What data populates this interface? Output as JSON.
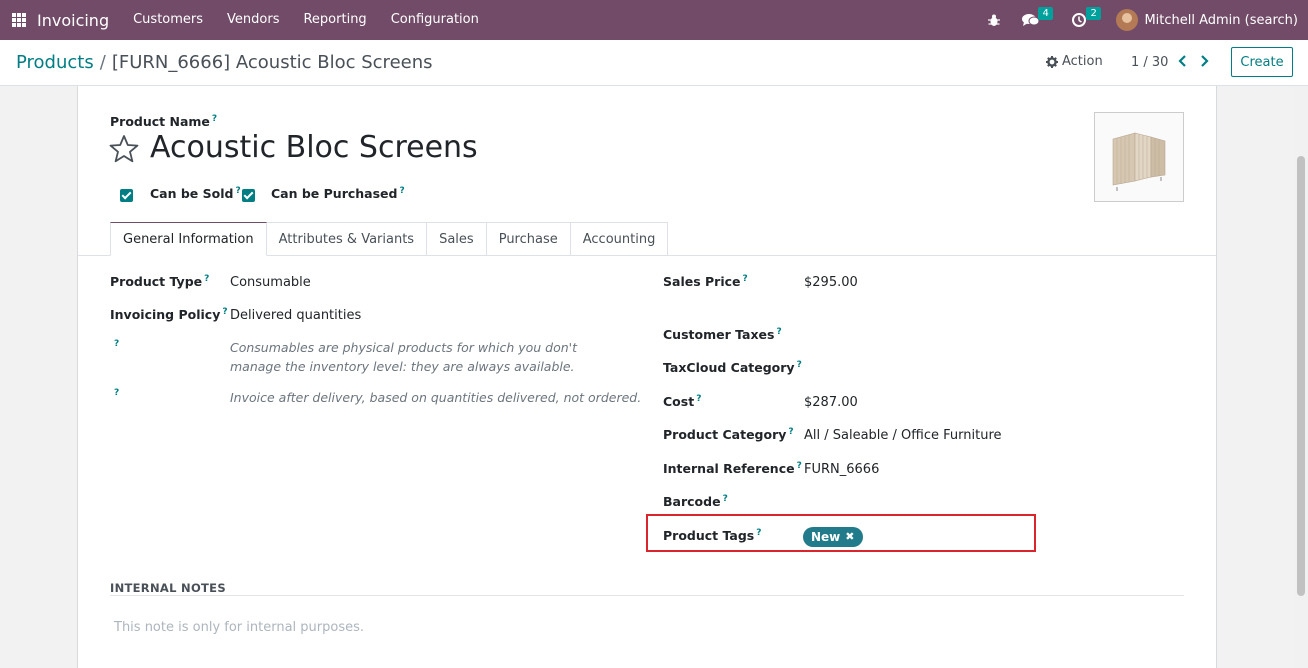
{
  "navbar": {
    "app_name": "Invoicing",
    "menu": [
      "Customers",
      "Vendors",
      "Reporting",
      "Configuration"
    ],
    "messages_count": "4",
    "activities_count": "2",
    "user": "Mitchell Admin (search)"
  },
  "breadcrumb": {
    "parent": "Products",
    "separator": "/",
    "current": "[FURN_6666] Acoustic Bloc Screens"
  },
  "control": {
    "action_label": "Action",
    "pager": "1 / 30",
    "create_label": "Create"
  },
  "form": {
    "product_name_label": "Product Name",
    "product_name": "Acoustic Bloc Screens",
    "can_be_sold_label": "Can be Sold",
    "can_be_purchased_label": "Can be Purchased",
    "tabs": [
      "General Information",
      "Attributes & Variants",
      "Sales",
      "Purchase",
      "Accounting"
    ],
    "left": {
      "product_type_label": "Product Type",
      "product_type": "Consumable",
      "invoicing_policy_label": "Invoicing Policy",
      "invoicing_policy": "Delivered quantities",
      "help_1": "Consumables are physical products for which you don't manage the inventory level: they are always available.",
      "help_2": "Invoice after delivery, based on quantities delivered, not ordered."
    },
    "right": {
      "sales_price_label": "Sales Price",
      "sales_price": "$295.00",
      "customer_taxes_label": "Customer Taxes",
      "taxcloud_label": "TaxCloud Category",
      "cost_label": "Cost",
      "cost": "$287.00",
      "category_label": "Product Category",
      "category": "All / Saleable / Office Furniture",
      "internal_ref_label": "Internal Reference",
      "internal_ref": "FURN_6666",
      "barcode_label": "Barcode",
      "tags_label": "Product Tags",
      "tag": "New"
    },
    "notes_header": "INTERNAL NOTES",
    "notes_placeholder": "This note is only for internal purposes."
  },
  "tooltip_marker": "?",
  "colors": {
    "navbar": "#714b67",
    "accent": "#017e84",
    "tag": "#217b8a",
    "highlight": "#d9252b"
  }
}
